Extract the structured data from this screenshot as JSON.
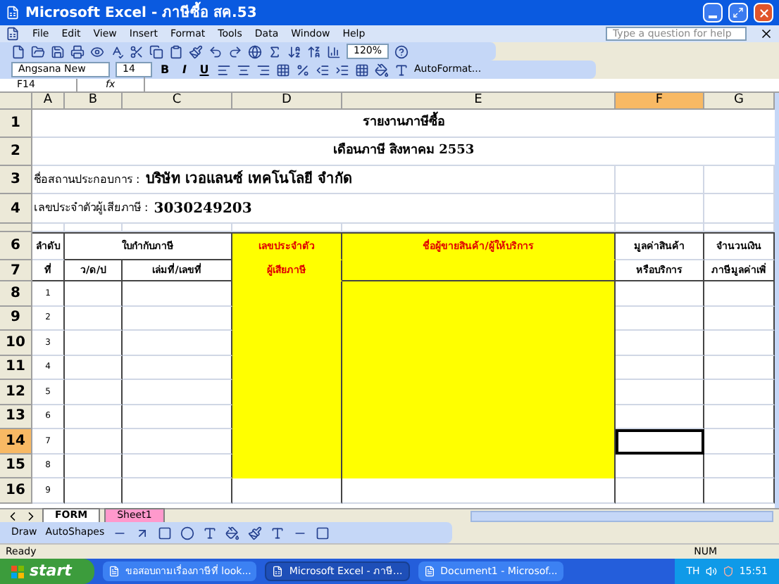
{
  "window": {
    "title": "Microsoft Excel - ภาษีซื้อ สค.53"
  },
  "menu": [
    "File",
    "Edit",
    "View",
    "Insert",
    "Format",
    "Tools",
    "Data",
    "Window",
    "Help"
  ],
  "help_box": {
    "placeholder": "Type a question for help"
  },
  "toolbar": {
    "zoom": "120%"
  },
  "format_toolbar": {
    "font": "Angsana New",
    "size": "14",
    "style_buttons": [
      "B",
      "I",
      "U"
    ],
    "autoformat": "AutoFormat..."
  },
  "formula_bar": {
    "name_box": "F14",
    "function_label": "fx"
  },
  "columns": [
    {
      "label": "A",
      "selected": false
    },
    {
      "label": "B",
      "selected": false
    },
    {
      "label": "C",
      "selected": false
    },
    {
      "label": "D",
      "selected": false
    },
    {
      "label": "E",
      "selected": false
    },
    {
      "label": "F",
      "selected": true
    },
    {
      "label": "G",
      "selected": false
    }
  ],
  "top_row_numbers": [
    "1",
    "2",
    "3",
    "4"
  ],
  "report": {
    "title": "รายงานภาษีซื้อ",
    "period": "เดือนภาษี สิงหาคม  2553",
    "company_label": "ชื่อสถานประกอบการ :",
    "company_name": "บริษัท เวอแลนซ์ เทคโนโลยี จำกัด",
    "taxid_label": "เลขประจำตัวผู้เสียภาษี :",
    "taxid": "3030249203"
  },
  "header_row_numbers": [
    "6",
    "7"
  ],
  "table_header": {
    "seq": [
      "ลำดับ",
      "ที่"
    ],
    "invoice": "ใบกำกับภาษี",
    "date": "ว/ด/ป",
    "book_no": "เล่มที่/เลขที่",
    "taxid": [
      "เลขประจำตัว",
      "ผู้เสียภาษี"
    ],
    "seller": "ชื่อผู้ขายสินค้า/ผู้ให้บริการ",
    "value": [
      "มูลค่าสินค้า",
      "หรือบริการ"
    ],
    "column_g": [
      "จำนวนเงิน",
      "ภาษีมูลค่าเพิ่"
    ]
  },
  "data_rows": [
    {
      "number": "8",
      "seq": "1",
      "selected": false,
      "highlighted": true
    },
    {
      "number": "9",
      "seq": "2",
      "selected": false,
      "highlighted": true
    },
    {
      "number": "10",
      "seq": "3",
      "selected": false,
      "highlighted": true
    },
    {
      "number": "11",
      "seq": "4",
      "selected": false,
      "highlighted": true
    },
    {
      "number": "12",
      "seq": "5",
      "selected": false,
      "highlighted": true
    },
    {
      "number": "13",
      "seq": "6",
      "selected": false,
      "highlighted": true
    },
    {
      "number": "14",
      "seq": "7",
      "selected": true,
      "highlighted": true
    },
    {
      "number": "15",
      "seq": "8",
      "selected": false,
      "highlighted": true
    },
    {
      "number": "16",
      "seq": "9",
      "selected": false,
      "highlighted": false
    }
  ],
  "sheet_tabs": [
    {
      "label": "FORM",
      "selected": true
    },
    {
      "label": "Sheet1",
      "selected": false,
      "color": "#ff99cc"
    }
  ],
  "draw_toolbar": {
    "draw": "Draw",
    "autoshapes": "AutoShapes"
  },
  "status_bar": {
    "status": "Ready",
    "num": "NUM"
  },
  "taskbar": {
    "start": "start",
    "tasks": [
      {
        "label": "ขอสอบถามเรื่องภาษีที่ look...",
        "selected": false
      },
      {
        "label": "Microsoft Excel - ภาษี...",
        "selected": true
      },
      {
        "label": "Document1 - Microsof...",
        "selected": false
      }
    ],
    "language": "TH",
    "clock": "15:51"
  }
}
